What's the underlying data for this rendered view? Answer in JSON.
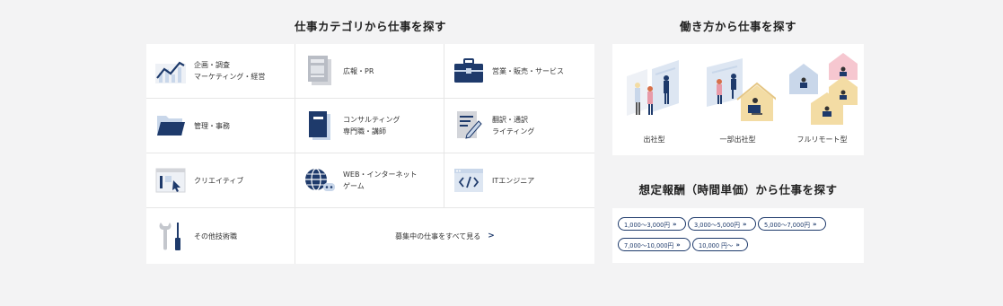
{
  "category_section": {
    "title": "仕事カテゴリから仕事を探す",
    "items": [
      {
        "label": "企画・調査\nマーケティング・経営",
        "icon": "chart-icon"
      },
      {
        "label": "広報・PR",
        "icon": "document-icon"
      },
      {
        "label": "営業・販売・サービス",
        "icon": "briefcase-icon"
      },
      {
        "label": "管理・事務",
        "icon": "folder-icon"
      },
      {
        "label": "コンサルティング\n専門職・講師",
        "icon": "book-icon"
      },
      {
        "label": "翻訳・通訳\nライティング",
        "icon": "pencil-document-icon"
      },
      {
        "label": "クリエイティブ",
        "icon": "design-window-icon"
      },
      {
        "label": "WEB・インターネット\nゲーム",
        "icon": "globe-icon"
      },
      {
        "label": "ITエンジニア",
        "icon": "code-window-icon"
      },
      {
        "label": "その他技術職",
        "icon": "tools-icon"
      }
    ],
    "see_all": {
      "label": "募集中の仕事をすべて見る",
      "chevron": ">"
    }
  },
  "style_section": {
    "title": "働き方から仕事を探す",
    "items": [
      {
        "label": "出社型"
      },
      {
        "label": "一部出社型"
      },
      {
        "label": "フルリモート型"
      }
    ]
  },
  "rate_section": {
    "title": "想定報酬（時間単価）から仕事を探す",
    "pills": [
      {
        "label": "1,000～3,000円"
      },
      {
        "label": "3,000～5,000円"
      },
      {
        "label": "5,000～7,000円"
      },
      {
        "label": "7,000～10,000円"
      },
      {
        "label": "10,000 円～"
      }
    ],
    "chevron": "»"
  },
  "colors": {
    "navy": "#1e3a6b",
    "light_blue": "#c9d7ea",
    "gray": "#d9d9dc",
    "pink": "#e89aa8",
    "yellow": "#f3dca4"
  }
}
